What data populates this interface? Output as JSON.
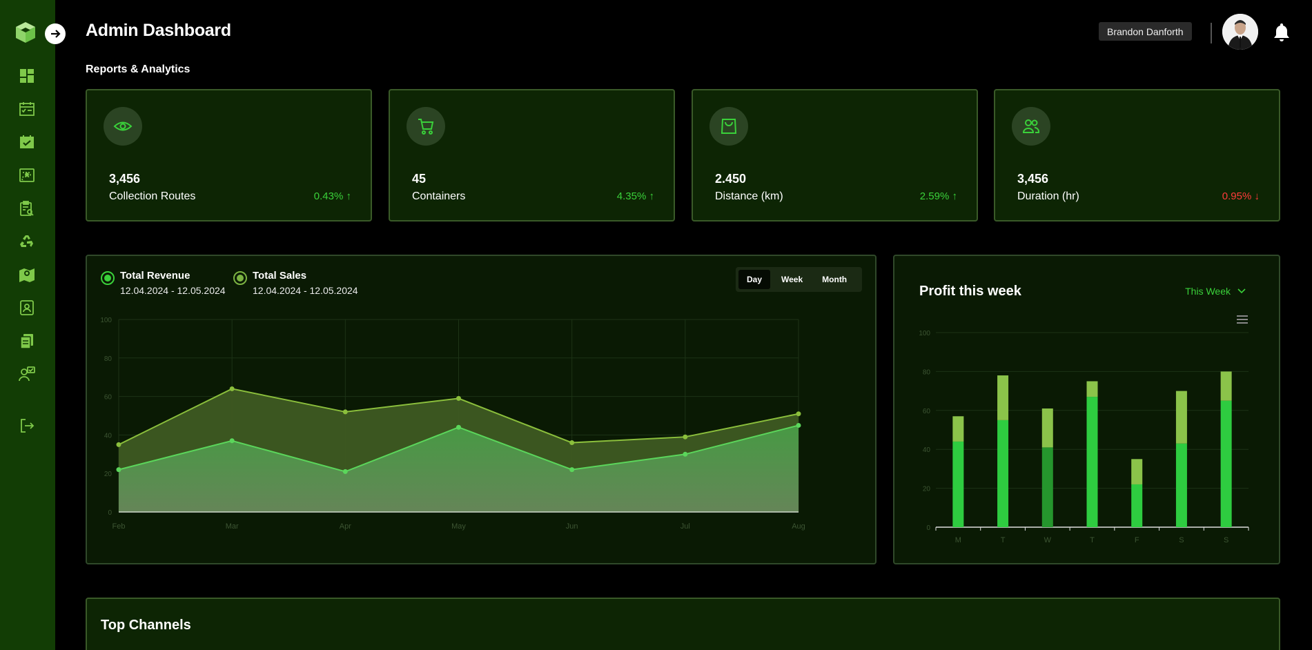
{
  "app": {
    "title": "Admin Dashboard",
    "user_name": "Brandon Danforth"
  },
  "sidebar": {
    "items": [
      {
        "name": "dashboard",
        "icon": "dashboard-icon"
      },
      {
        "name": "schedule",
        "icon": "calendar-checklist-icon"
      },
      {
        "name": "calendar",
        "icon": "calendar-check-icon"
      },
      {
        "name": "routes",
        "icon": "route-icon"
      },
      {
        "name": "reports",
        "icon": "clipboard-search-icon"
      },
      {
        "name": "recycling",
        "icon": "recycle-icon"
      },
      {
        "name": "map",
        "icon": "map-pin-icon"
      },
      {
        "name": "contacts",
        "icon": "contact-card-icon"
      },
      {
        "name": "documents",
        "icon": "documents-icon"
      },
      {
        "name": "support",
        "icon": "support-user-icon"
      }
    ],
    "logout_icon": "logout-icon"
  },
  "section": {
    "title": "Reports & Analytics"
  },
  "stats": [
    {
      "value": "3,456",
      "label": "Collection Routes",
      "change": "0.43% ↑",
      "trend": "up",
      "icon": "eye-icon"
    },
    {
      "value": "45",
      "label": "Containers",
      "change": "4.35% ↑",
      "trend": "up",
      "icon": "cart-icon"
    },
    {
      "value": "2.450",
      "label": "Distance (km)",
      "change": "2.59% ↑",
      "trend": "up",
      "icon": "bag-icon"
    },
    {
      "value": "3,456",
      "label": "Duration (hr)",
      "change": "0.95% ↓",
      "trend": "down",
      "icon": "users-icon"
    }
  ],
  "revenue_chart": {
    "legend": [
      {
        "name": "Total Revenue",
        "range": "12.04.2024 - 12.05.2024",
        "color": "#3ad13a"
      },
      {
        "name": "Total Sales",
        "range": "12.04.2024 - 12.05.2024",
        "color": "#7cb342"
      }
    ],
    "range_options": [
      "Day",
      "Week",
      "Month"
    ],
    "active_range": "Day"
  },
  "profit": {
    "title": "Profit this week",
    "period": "This Week"
  },
  "channels": {
    "title": "Top Channels"
  },
  "colors": {
    "accent": "#3ad13a",
    "sidebar": "#123d05",
    "card_bg": "#0d2504",
    "down": "#ff3b3b"
  },
  "chart_data": [
    {
      "type": "area",
      "categories": [
        "Feb",
        "Mar",
        "Apr",
        "May",
        "Jun",
        "Jul",
        "Aug"
      ],
      "ylim": [
        0,
        100
      ],
      "yticks": [
        0,
        20,
        40,
        60,
        80,
        100
      ],
      "series": [
        {
          "name": "Total Revenue",
          "values": [
            22,
            37,
            21,
            44,
            22,
            30,
            45
          ],
          "color": "#5bd65b"
        },
        {
          "name": "Total Sales",
          "values": [
            35,
            64,
            52,
            59,
            36,
            39,
            51
          ],
          "color": "#8bbf3c"
        }
      ]
    },
    {
      "type": "bar",
      "stacked": true,
      "categories": [
        "M",
        "T",
        "W",
        "T",
        "F",
        "S",
        "S"
      ],
      "ylim": [
        0,
        100
      ],
      "yticks": [
        0,
        20,
        40,
        60,
        80,
        100
      ],
      "series": [
        {
          "values": [
            44,
            55,
            41,
            67,
            22,
            43,
            65
          ],
          "color": "#2ecc40"
        },
        {
          "values": [
            13,
            23,
            20,
            8,
            13,
            27,
            15
          ],
          "color": "#8bc34a"
        }
      ]
    }
  ]
}
